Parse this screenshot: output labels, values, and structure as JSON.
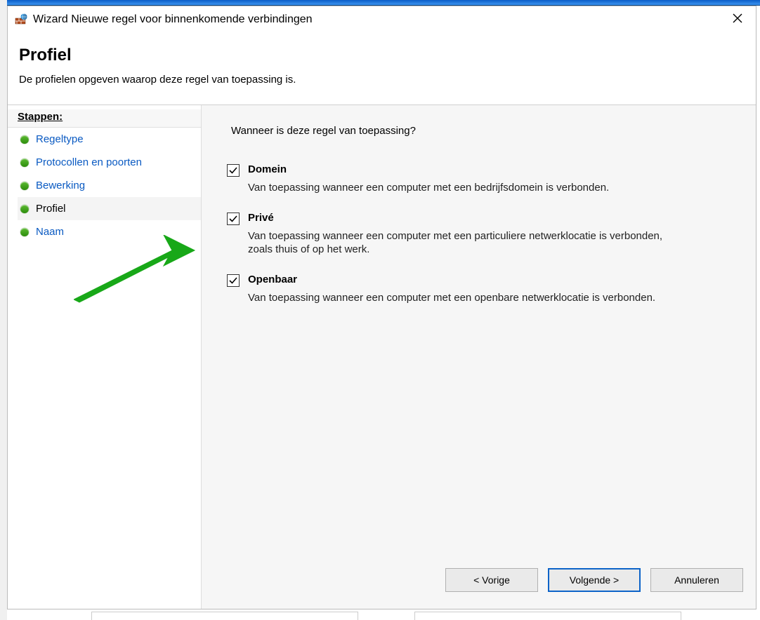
{
  "window": {
    "title": "Wizard Nieuwe regel voor binnenkomende verbindingen"
  },
  "header": {
    "title": "Profiel",
    "subtitle": "De profielen opgeven waarop deze regel van toepassing is."
  },
  "sidebar": {
    "heading": "Stappen:",
    "items": [
      {
        "label": "Regeltype",
        "current": false
      },
      {
        "label": "Protocollen en poorten",
        "current": false
      },
      {
        "label": "Bewerking",
        "current": false
      },
      {
        "label": "Profiel",
        "current": true
      },
      {
        "label": "Naam",
        "current": false
      }
    ]
  },
  "content": {
    "question": "Wanneer is deze regel van toepassing?",
    "checkboxes": [
      {
        "label": "Domein",
        "checked": true,
        "description": "Van toepassing wanneer een computer met een bedrijfsdomein is verbonden."
      },
      {
        "label": "Privé",
        "checked": true,
        "description": "Van toepassing wanneer een computer met een particuliere netwerklocatie is verbonden, zoals thuis of op het werk."
      },
      {
        "label": "Openbaar",
        "checked": true,
        "description": "Van toepassing wanneer een computer met een openbare netwerklocatie is verbonden."
      }
    ]
  },
  "buttons": {
    "back": "< Vorige",
    "next": "Volgende >",
    "cancel": "Annuleren"
  }
}
